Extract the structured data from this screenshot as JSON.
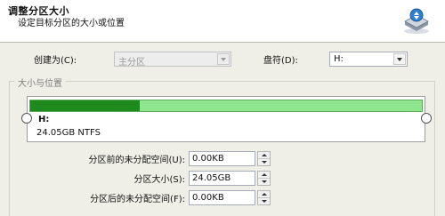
{
  "header": {
    "title": "调整分区大小",
    "subtitle": "设定目标分区的大小或位置"
  },
  "fields": {
    "create_as_label": "创建为(C):",
    "create_as_value": "主分区",
    "drive_letter_label": "盘符(D):",
    "drive_letter_value": "H:"
  },
  "group": {
    "title": "大小与位置"
  },
  "partition": {
    "name": "H:",
    "info": "24.05GB NTFS",
    "used_fraction": 0.28
  },
  "spinners": [
    {
      "label": "分区前的未分配空间(U):",
      "value": "0.00KB"
    },
    {
      "label": "分区大小(S):",
      "value": "24.05GB"
    },
    {
      "label": "分区后的未分配空间(F):",
      "value": "0.00KB"
    }
  ],
  "colors": {
    "bar_used": "#1e8a1e",
    "bar_free": "#8fe68f"
  }
}
